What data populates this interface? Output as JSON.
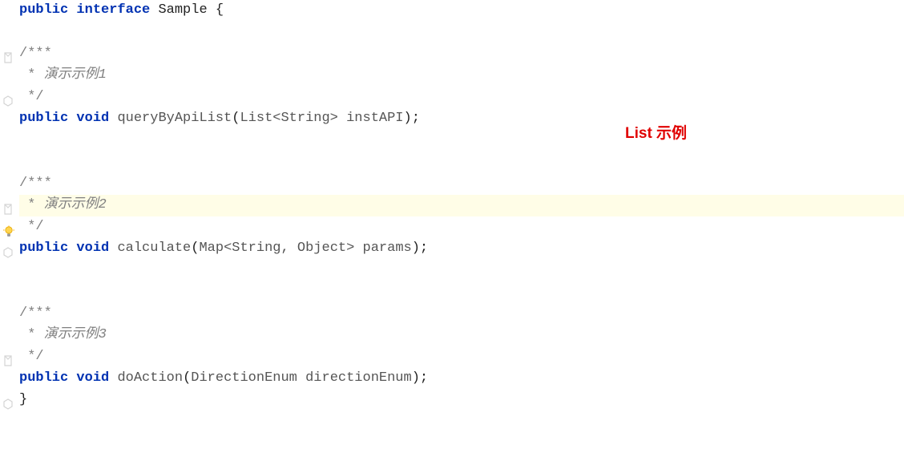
{
  "code": {
    "declaration": {
      "public": "public",
      "interface": "interface",
      "name": "Sample",
      "open": "{"
    },
    "blocks": [
      {
        "comment_open": "/***",
        "comment_body_prefix": " * ",
        "comment_body": "演示示例1",
        "comment_close": " */",
        "public": "public",
        "void": "void",
        "method": "queryByApiList",
        "params_open": "(",
        "param_type": "List<String>",
        "param_name": " instAPI",
        "params_close": ");"
      },
      {
        "comment_open": "/***",
        "comment_body_prefix": " * ",
        "comment_body": "演示示例2",
        "comment_close": " */",
        "public": "public",
        "void": "void",
        "method": "calculate",
        "params_open": "(",
        "param_type": "Map<String, Object>",
        "param_name": " params",
        "params_close": ");"
      },
      {
        "comment_open": "/***",
        "comment_body_prefix": " * ",
        "comment_body": "演示示例3",
        "comment_close": " */",
        "public": "public",
        "void": "void",
        "method": "doAction",
        "params_open": "(",
        "param_type": "DirectionEnum",
        "param_name": " directionEnum",
        "params_close": ");"
      }
    ],
    "close": "}"
  },
  "annotation": {
    "text": "List 示例"
  },
  "icons": {
    "bulb": "lightbulb-icon",
    "method": "method-marker-icon"
  }
}
